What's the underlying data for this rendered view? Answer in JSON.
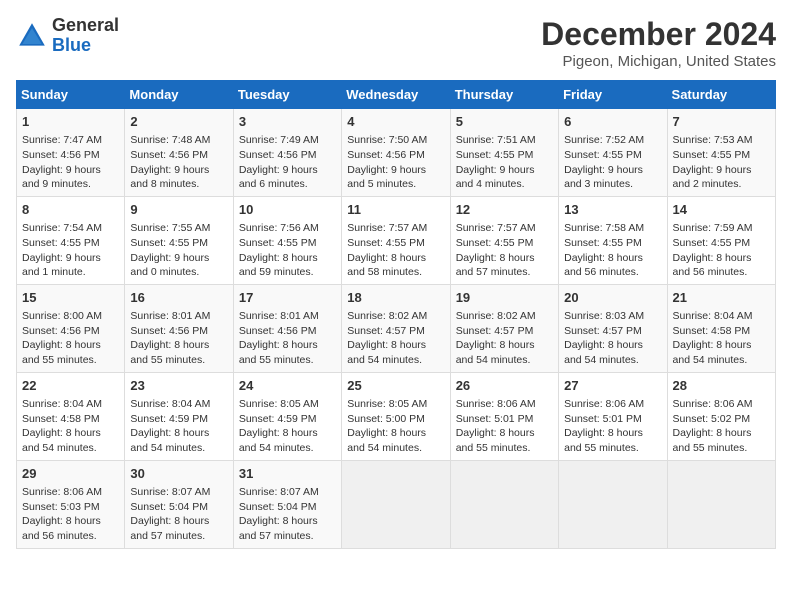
{
  "logo": {
    "line1": "General",
    "line2": "Blue"
  },
  "title": "December 2024",
  "subtitle": "Pigeon, Michigan, United States",
  "days_of_week": [
    "Sunday",
    "Monday",
    "Tuesday",
    "Wednesday",
    "Thursday",
    "Friday",
    "Saturday"
  ],
  "weeks": [
    [
      {
        "day": "1",
        "info": "Sunrise: 7:47 AM\nSunset: 4:56 PM\nDaylight: 9 hours and 9 minutes."
      },
      {
        "day": "2",
        "info": "Sunrise: 7:48 AM\nSunset: 4:56 PM\nDaylight: 9 hours and 8 minutes."
      },
      {
        "day": "3",
        "info": "Sunrise: 7:49 AM\nSunset: 4:56 PM\nDaylight: 9 hours and 6 minutes."
      },
      {
        "day": "4",
        "info": "Sunrise: 7:50 AM\nSunset: 4:56 PM\nDaylight: 9 hours and 5 minutes."
      },
      {
        "day": "5",
        "info": "Sunrise: 7:51 AM\nSunset: 4:55 PM\nDaylight: 9 hours and 4 minutes."
      },
      {
        "day": "6",
        "info": "Sunrise: 7:52 AM\nSunset: 4:55 PM\nDaylight: 9 hours and 3 minutes."
      },
      {
        "day": "7",
        "info": "Sunrise: 7:53 AM\nSunset: 4:55 PM\nDaylight: 9 hours and 2 minutes."
      }
    ],
    [
      {
        "day": "8",
        "info": "Sunrise: 7:54 AM\nSunset: 4:55 PM\nDaylight: 9 hours and 1 minute."
      },
      {
        "day": "9",
        "info": "Sunrise: 7:55 AM\nSunset: 4:55 PM\nDaylight: 9 hours and 0 minutes."
      },
      {
        "day": "10",
        "info": "Sunrise: 7:56 AM\nSunset: 4:55 PM\nDaylight: 8 hours and 59 minutes."
      },
      {
        "day": "11",
        "info": "Sunrise: 7:57 AM\nSunset: 4:55 PM\nDaylight: 8 hours and 58 minutes."
      },
      {
        "day": "12",
        "info": "Sunrise: 7:57 AM\nSunset: 4:55 PM\nDaylight: 8 hours and 57 minutes."
      },
      {
        "day": "13",
        "info": "Sunrise: 7:58 AM\nSunset: 4:55 PM\nDaylight: 8 hours and 56 minutes."
      },
      {
        "day": "14",
        "info": "Sunrise: 7:59 AM\nSunset: 4:55 PM\nDaylight: 8 hours and 56 minutes."
      }
    ],
    [
      {
        "day": "15",
        "info": "Sunrise: 8:00 AM\nSunset: 4:56 PM\nDaylight: 8 hours and 55 minutes."
      },
      {
        "day": "16",
        "info": "Sunrise: 8:01 AM\nSunset: 4:56 PM\nDaylight: 8 hours and 55 minutes."
      },
      {
        "day": "17",
        "info": "Sunrise: 8:01 AM\nSunset: 4:56 PM\nDaylight: 8 hours and 55 minutes."
      },
      {
        "day": "18",
        "info": "Sunrise: 8:02 AM\nSunset: 4:57 PM\nDaylight: 8 hours and 54 minutes."
      },
      {
        "day": "19",
        "info": "Sunrise: 8:02 AM\nSunset: 4:57 PM\nDaylight: 8 hours and 54 minutes."
      },
      {
        "day": "20",
        "info": "Sunrise: 8:03 AM\nSunset: 4:57 PM\nDaylight: 8 hours and 54 minutes."
      },
      {
        "day": "21",
        "info": "Sunrise: 8:04 AM\nSunset: 4:58 PM\nDaylight: 8 hours and 54 minutes."
      }
    ],
    [
      {
        "day": "22",
        "info": "Sunrise: 8:04 AM\nSunset: 4:58 PM\nDaylight: 8 hours and 54 minutes."
      },
      {
        "day": "23",
        "info": "Sunrise: 8:04 AM\nSunset: 4:59 PM\nDaylight: 8 hours and 54 minutes."
      },
      {
        "day": "24",
        "info": "Sunrise: 8:05 AM\nSunset: 4:59 PM\nDaylight: 8 hours and 54 minutes."
      },
      {
        "day": "25",
        "info": "Sunrise: 8:05 AM\nSunset: 5:00 PM\nDaylight: 8 hours and 54 minutes."
      },
      {
        "day": "26",
        "info": "Sunrise: 8:06 AM\nSunset: 5:01 PM\nDaylight: 8 hours and 55 minutes."
      },
      {
        "day": "27",
        "info": "Sunrise: 8:06 AM\nSunset: 5:01 PM\nDaylight: 8 hours and 55 minutes."
      },
      {
        "day": "28",
        "info": "Sunrise: 8:06 AM\nSunset: 5:02 PM\nDaylight: 8 hours and 55 minutes."
      }
    ],
    [
      {
        "day": "29",
        "info": "Sunrise: 8:06 AM\nSunset: 5:03 PM\nDaylight: 8 hours and 56 minutes."
      },
      {
        "day": "30",
        "info": "Sunrise: 8:07 AM\nSunset: 5:04 PM\nDaylight: 8 hours and 57 minutes."
      },
      {
        "day": "31",
        "info": "Sunrise: 8:07 AM\nSunset: 5:04 PM\nDaylight: 8 hours and 57 minutes."
      },
      {
        "day": "",
        "info": ""
      },
      {
        "day": "",
        "info": ""
      },
      {
        "day": "",
        "info": ""
      },
      {
        "day": "",
        "info": ""
      }
    ]
  ]
}
